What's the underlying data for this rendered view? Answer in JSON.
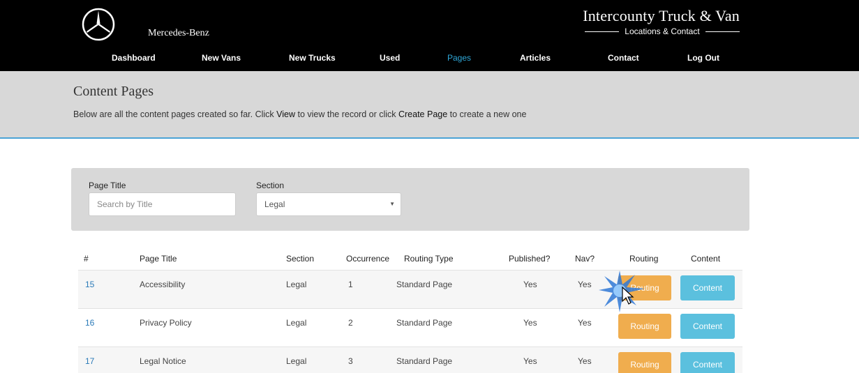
{
  "header": {
    "brand": "Mercedes-Benz",
    "dealer_title": "Intercounty Truck & Van",
    "dealer_subtitle": "Locations & Contact",
    "logo_icon": "mercedes-star-icon"
  },
  "nav": {
    "items": [
      {
        "label": "Dashboard"
      },
      {
        "label": "New Vans"
      },
      {
        "label": "New Trucks"
      },
      {
        "label": "Used"
      },
      {
        "label": "Pages"
      },
      {
        "label": "Articles"
      },
      {
        "label": "Contact"
      },
      {
        "label": "Log Out"
      }
    ],
    "active": "Pages",
    "active_color": "#2fa8d9"
  },
  "page": {
    "title": "Content Pages",
    "desc_1": "Below are all the content pages created so far. Click ",
    "desc_view": "View",
    "desc_2": " to view the record or click ",
    "desc_create": "Create Page",
    "desc_3": " to create a new one"
  },
  "filters": {
    "title_label": "Page Title",
    "title_placeholder": "Search by Title",
    "section_label": "Section",
    "section_value": "Legal"
  },
  "table": {
    "headers": [
      "#",
      "Page Title",
      "Section",
      "Occurrence",
      "Routing Type",
      "Published?",
      "Nav?",
      "Routing",
      "Content"
    ],
    "rows": [
      {
        "id": "15",
        "title": "Accessibility",
        "section": "Legal",
        "occurrence": "1",
        "routing_type": "Standard Page",
        "published": "Yes",
        "nav": "Yes",
        "routing_btn": "Routing",
        "content_btn": "Content"
      },
      {
        "id": "16",
        "title": "Privacy Policy",
        "section": "Legal",
        "occurrence": "2",
        "routing_type": "Standard Page",
        "published": "Yes",
        "nav": "Yes",
        "routing_btn": "Routing",
        "content_btn": "Content"
      },
      {
        "id": "17",
        "title": "Legal Notice",
        "section": "Legal",
        "occurrence": "3",
        "routing_type": "Standard Page",
        "published": "Yes",
        "nav": "Yes",
        "routing_btn": "Routing",
        "content_btn": "Content"
      }
    ]
  },
  "colors": {
    "routing": "#f0ad4e",
    "content": "#5bc0de",
    "link": "#2a7ab8"
  }
}
